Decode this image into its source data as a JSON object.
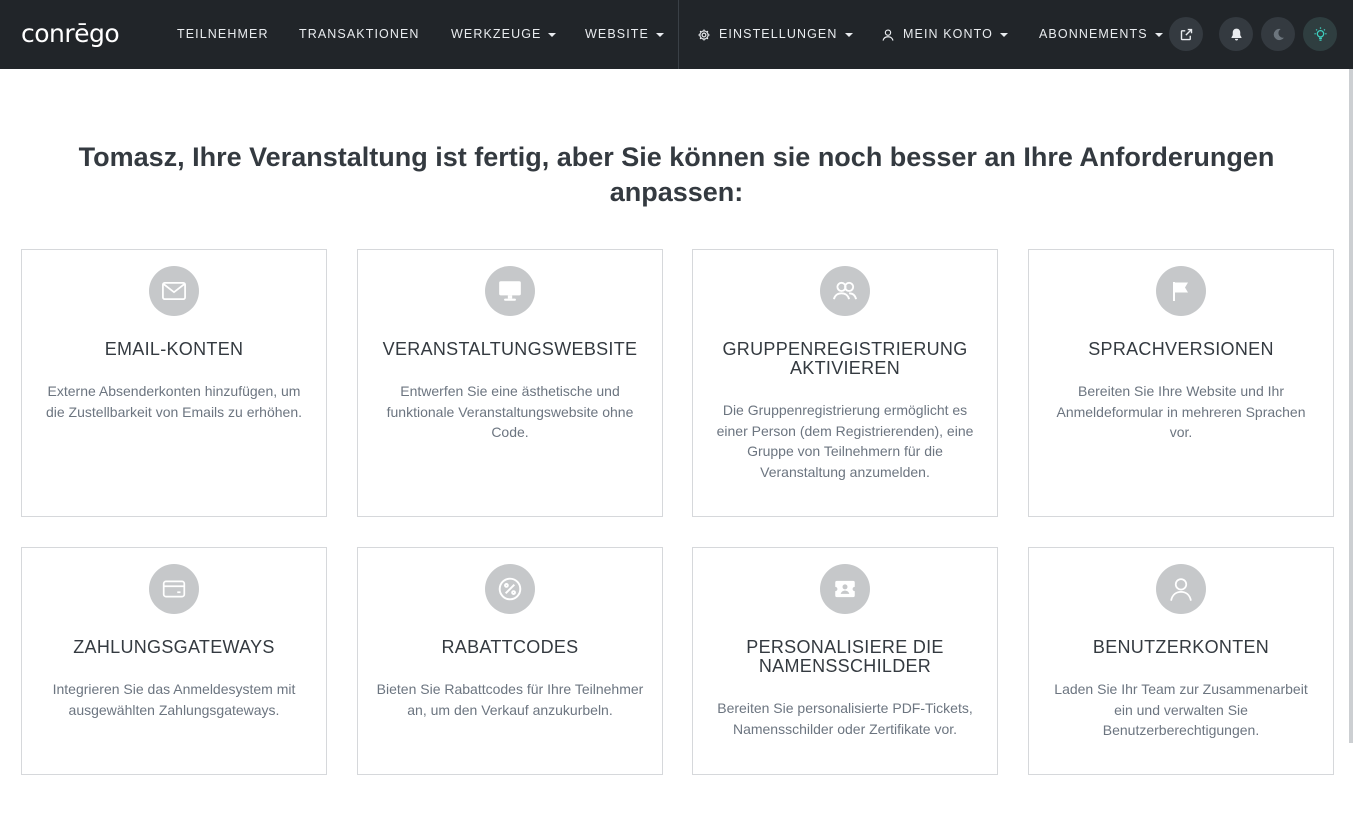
{
  "brand": {
    "logo_text": "conrēgo"
  },
  "nav": {
    "items": [
      {
        "label": "TEILNEHMER"
      },
      {
        "label": "TRANSAKTIONEN"
      },
      {
        "label": "WERKZEUGE"
      },
      {
        "label": "WEBSITE"
      },
      {
        "label": "EINSTELLUNGEN"
      },
      {
        "label": "MEIN KONTO"
      },
      {
        "label": "ABONNEMENTS"
      }
    ],
    "buttons": {
      "external_icon": "external-link-icon",
      "notifications_icon": "bell-icon",
      "dark_mode_icon": "moon-icon",
      "light_mode_icon": "sun-icon"
    }
  },
  "main": {
    "headline": "Tomasz, Ihre Veranstaltung ist fertig, aber Sie können sie noch besser an Ihre Anforderungen anpassen:",
    "cards": [
      {
        "icon": "envelope-icon",
        "title": "EMAIL-KONTEN",
        "text": "Externe Absenderkonten hinzufügen, um die Zustellbarkeit von Emails zu erhöhen."
      },
      {
        "icon": "monitor-icon",
        "title": "VERANSTALTUNGSWEBSITE",
        "text": "Entwerfen Sie eine ästhetische und funktionale Veranstaltungswebsite ohne Code."
      },
      {
        "icon": "users-icon",
        "title": "GRUPPENREGISTRIERUNG AKTIVIEREN",
        "text": "Die Gruppenregistrierung ermöglicht es einer Person (dem Registrierenden), eine Gruppe von Teilnehmern für die Veranstaltung anzumelden."
      },
      {
        "icon": "flag-icon",
        "title": "SPRACHVERSIONEN",
        "text": "Bereiten Sie Ihre Website und Ihr Anmeldeformular in mehreren Sprachen vor."
      },
      {
        "icon": "credit-card-icon",
        "title": "ZAHLUNGSGATEWAYS",
        "text": "Integrieren Sie das Anmeldesystem mit ausgewählten Zahlungsgateways."
      },
      {
        "icon": "percent-icon",
        "title": "RABATTCODES",
        "text": "Bieten Sie Rabattcodes für Ihre Teilnehmer an, um den Verkauf anzukurbeln."
      },
      {
        "icon": "badge-icon",
        "title": "PERSONALISIERE DIE NAMENSSCHILDER",
        "text": "Bereiten Sie personalisierte PDF-Tickets, Namensschilder oder Zertifikate vor."
      },
      {
        "icon": "user-icon",
        "title": "BENUTZERKONTEN",
        "text": "Laden Sie Ihr Team zur Zusammenarbeit ein und verwalten Sie Benutzerberechtigungen."
      }
    ]
  },
  "colors": {
    "navbar_bg": "#212529",
    "icon_circle": "#c6c8ca",
    "heading_text": "#343a40",
    "body_text": "#6c7580"
  }
}
